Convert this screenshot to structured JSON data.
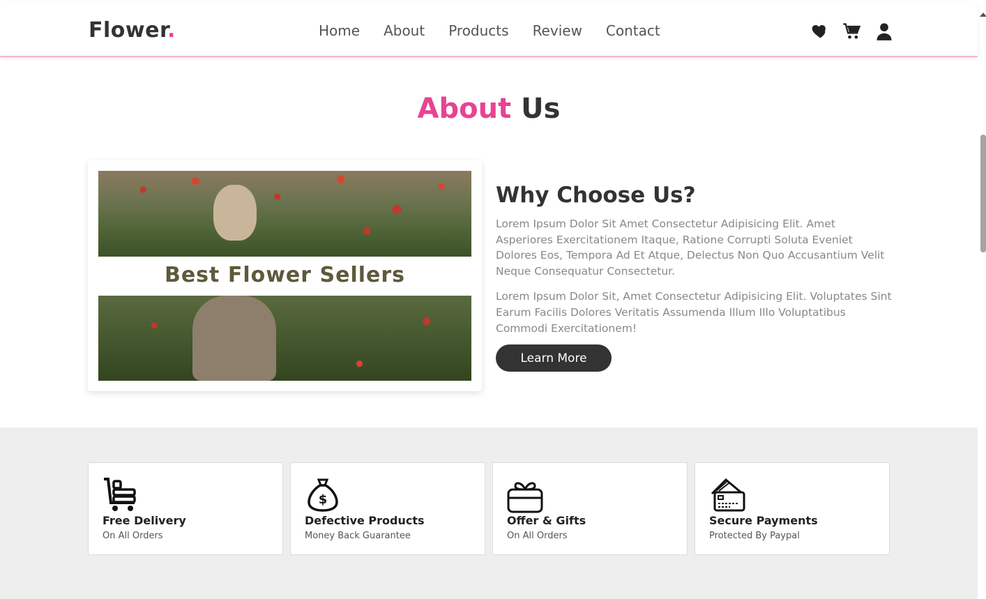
{
  "brand": {
    "name": "Flower",
    "dot": ".",
    "accent_color": "#e84393"
  },
  "nav": {
    "items": [
      "Home",
      "About",
      "Products",
      "Review",
      "Contact"
    ]
  },
  "header_icons": [
    "heart-icon",
    "cart-icon",
    "user-icon"
  ],
  "section": {
    "title_accent": "About",
    "title_rest": "Us"
  },
  "card": {
    "overlay_text": "Best Flower Sellers"
  },
  "why": {
    "title": "Why Choose Us?",
    "paragraph1": "Lorem Ipsum Dolor Sit Amet Consectetur Adipisicing Elit. Amet Asperiores Exercitationem Itaque, Ratione Corrupti Soluta Eveniet Dolores Eos, Tempora Ad Et Atque, Delectus Non Quo Accusantium Velit Neque Consequatur Consectetur.",
    "paragraph2": "Lorem Ipsum Dolor Sit, Amet Consectetur Adipisicing Elit. Voluptates Sint Earum Facilis Dolores Veritatis Assumenda Illum Illo Voluptatibus Commodi Exercitationem!",
    "button": "Learn More"
  },
  "features": [
    {
      "icon": "delivery-cart-icon",
      "title": "Free Delivery",
      "subtitle": "On All Orders"
    },
    {
      "icon": "money-bag-icon",
      "title": "Defective Products",
      "subtitle": "Money Back Guarantee"
    },
    {
      "icon": "gift-icon",
      "title": "Offer & Gifts",
      "subtitle": "On All Orders"
    },
    {
      "icon": "credit-card-icon",
      "title": "Secure Payments",
      "subtitle": "Protected By Paypal"
    }
  ]
}
